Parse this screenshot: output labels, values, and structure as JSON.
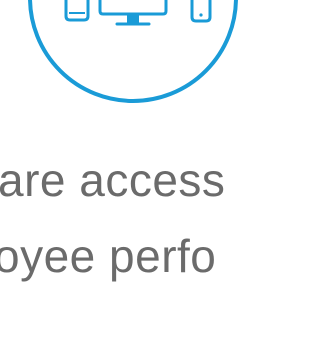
{
  "graphic": {
    "icon": "multi-device-icon",
    "accent_color": "#1a9bd7"
  },
  "text": {
    "line1": "are access",
    "line2": "oyee perfo"
  },
  "colors": {
    "text": "#6b6b6b",
    "background": "#ffffff"
  }
}
